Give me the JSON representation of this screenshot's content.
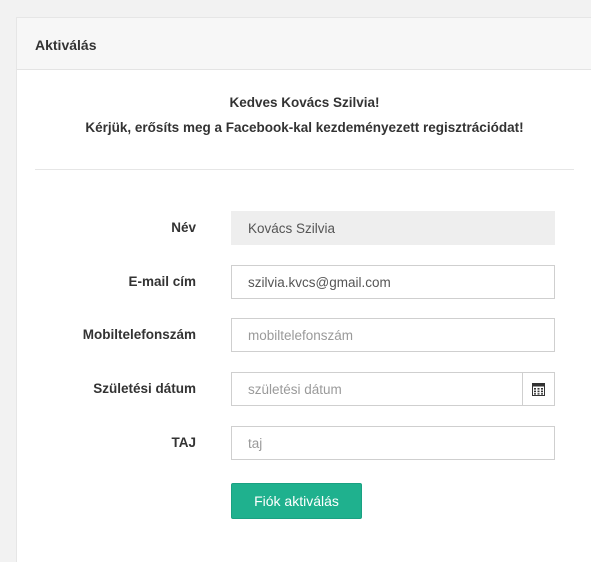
{
  "panel": {
    "title": "Aktiválás"
  },
  "greeting": {
    "line1": "Kedves Kovács Szilvia!",
    "line2": "Kérjük, erősíts meg a Facebook-kal kezdeményezett regisztrációdat!"
  },
  "form": {
    "name": {
      "label": "Név",
      "value": "Kovács Szilvia"
    },
    "email": {
      "label": "E-mail cím",
      "value": "szilvia.kvcs@gmail.com"
    },
    "phone": {
      "label": "Mobiltelefonszám",
      "value": "",
      "placeholder": "mobiltelefonszám"
    },
    "birthdate": {
      "label": "Születési dátum",
      "value": "",
      "placeholder": "születési dátum",
      "icon": "calendar-icon"
    },
    "taj": {
      "label": "TAJ",
      "value": "",
      "placeholder": "taj"
    },
    "submit_label": "Fiók aktiválás"
  },
  "colors": {
    "accent": "#1fb18e"
  }
}
